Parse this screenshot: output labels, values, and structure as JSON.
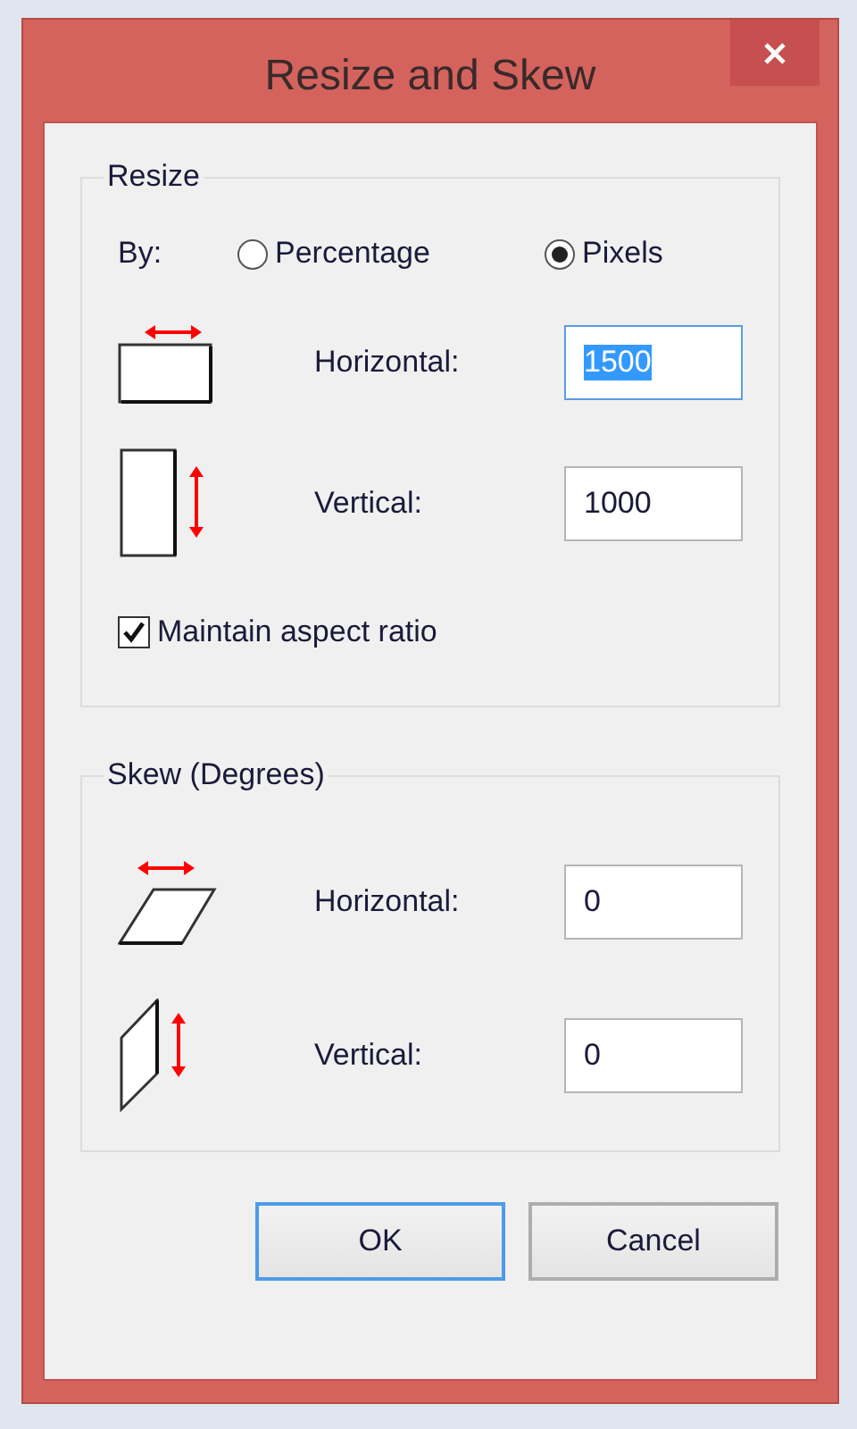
{
  "window": {
    "title": "Resize and Skew"
  },
  "resize": {
    "title": "Resize",
    "by_label": "By:",
    "units": [
      {
        "label": "Percentage",
        "selected": false
      },
      {
        "label": "Pixels",
        "selected": true
      }
    ],
    "fields": [
      {
        "kind": "resize-horizontal",
        "label": "Horizontal:",
        "value": "1500",
        "text_selected": true
      },
      {
        "kind": "resize-vertical",
        "label": "Vertical:",
        "value": "1000",
        "text_selected": false
      }
    ],
    "aspect": {
      "label": "Maintain aspect ratio",
      "checked": true
    }
  },
  "skew": {
    "title": "Skew (Degrees)",
    "fields": [
      {
        "kind": "skew-horizontal",
        "label": "Horizontal:",
        "value": "0",
        "text_selected": false
      },
      {
        "kind": "skew-vertical",
        "label": "Vertical:",
        "value": "0",
        "text_selected": false
      }
    ]
  },
  "buttons": [
    {
      "label": "OK",
      "default": true
    },
    {
      "label": "Cancel",
      "default": false
    }
  ]
}
